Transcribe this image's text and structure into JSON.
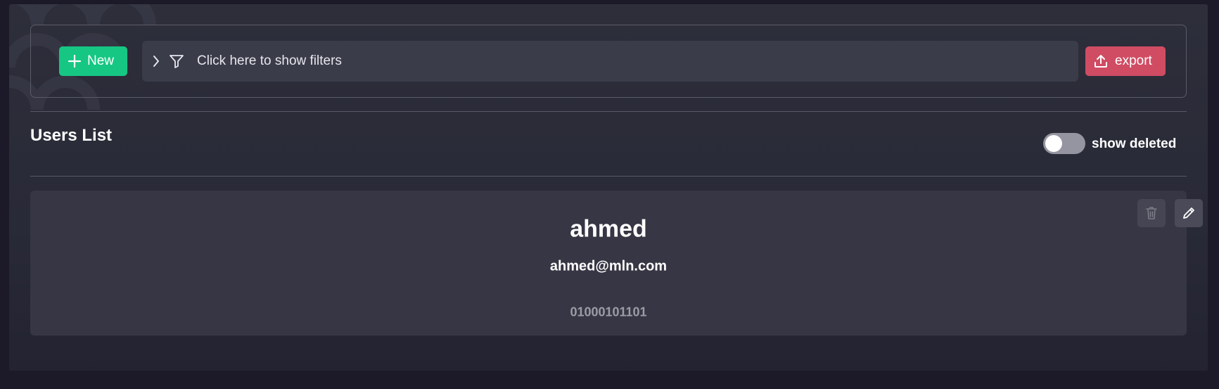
{
  "toolbar": {
    "new_label": "New",
    "filter_label": "Click here to show filters",
    "export_label": "export"
  },
  "users_section": {
    "title": "Users List",
    "show_deleted_label": "show deleted",
    "show_deleted_on": false
  },
  "users": [
    {
      "name": "ahmed",
      "email": "ahmed@mln.com",
      "phone": "01000101101"
    }
  ],
  "icons": {
    "new": "plus-icon",
    "filter_expand": "chevron-right-icon",
    "filter": "funnel-icon",
    "export": "upload-icon",
    "delete": "trash-icon",
    "edit": "pencil-icon"
  },
  "colors": {
    "new_button": "#16c784",
    "export_button": "#d04c63",
    "toggle_off": "#9594a1"
  }
}
